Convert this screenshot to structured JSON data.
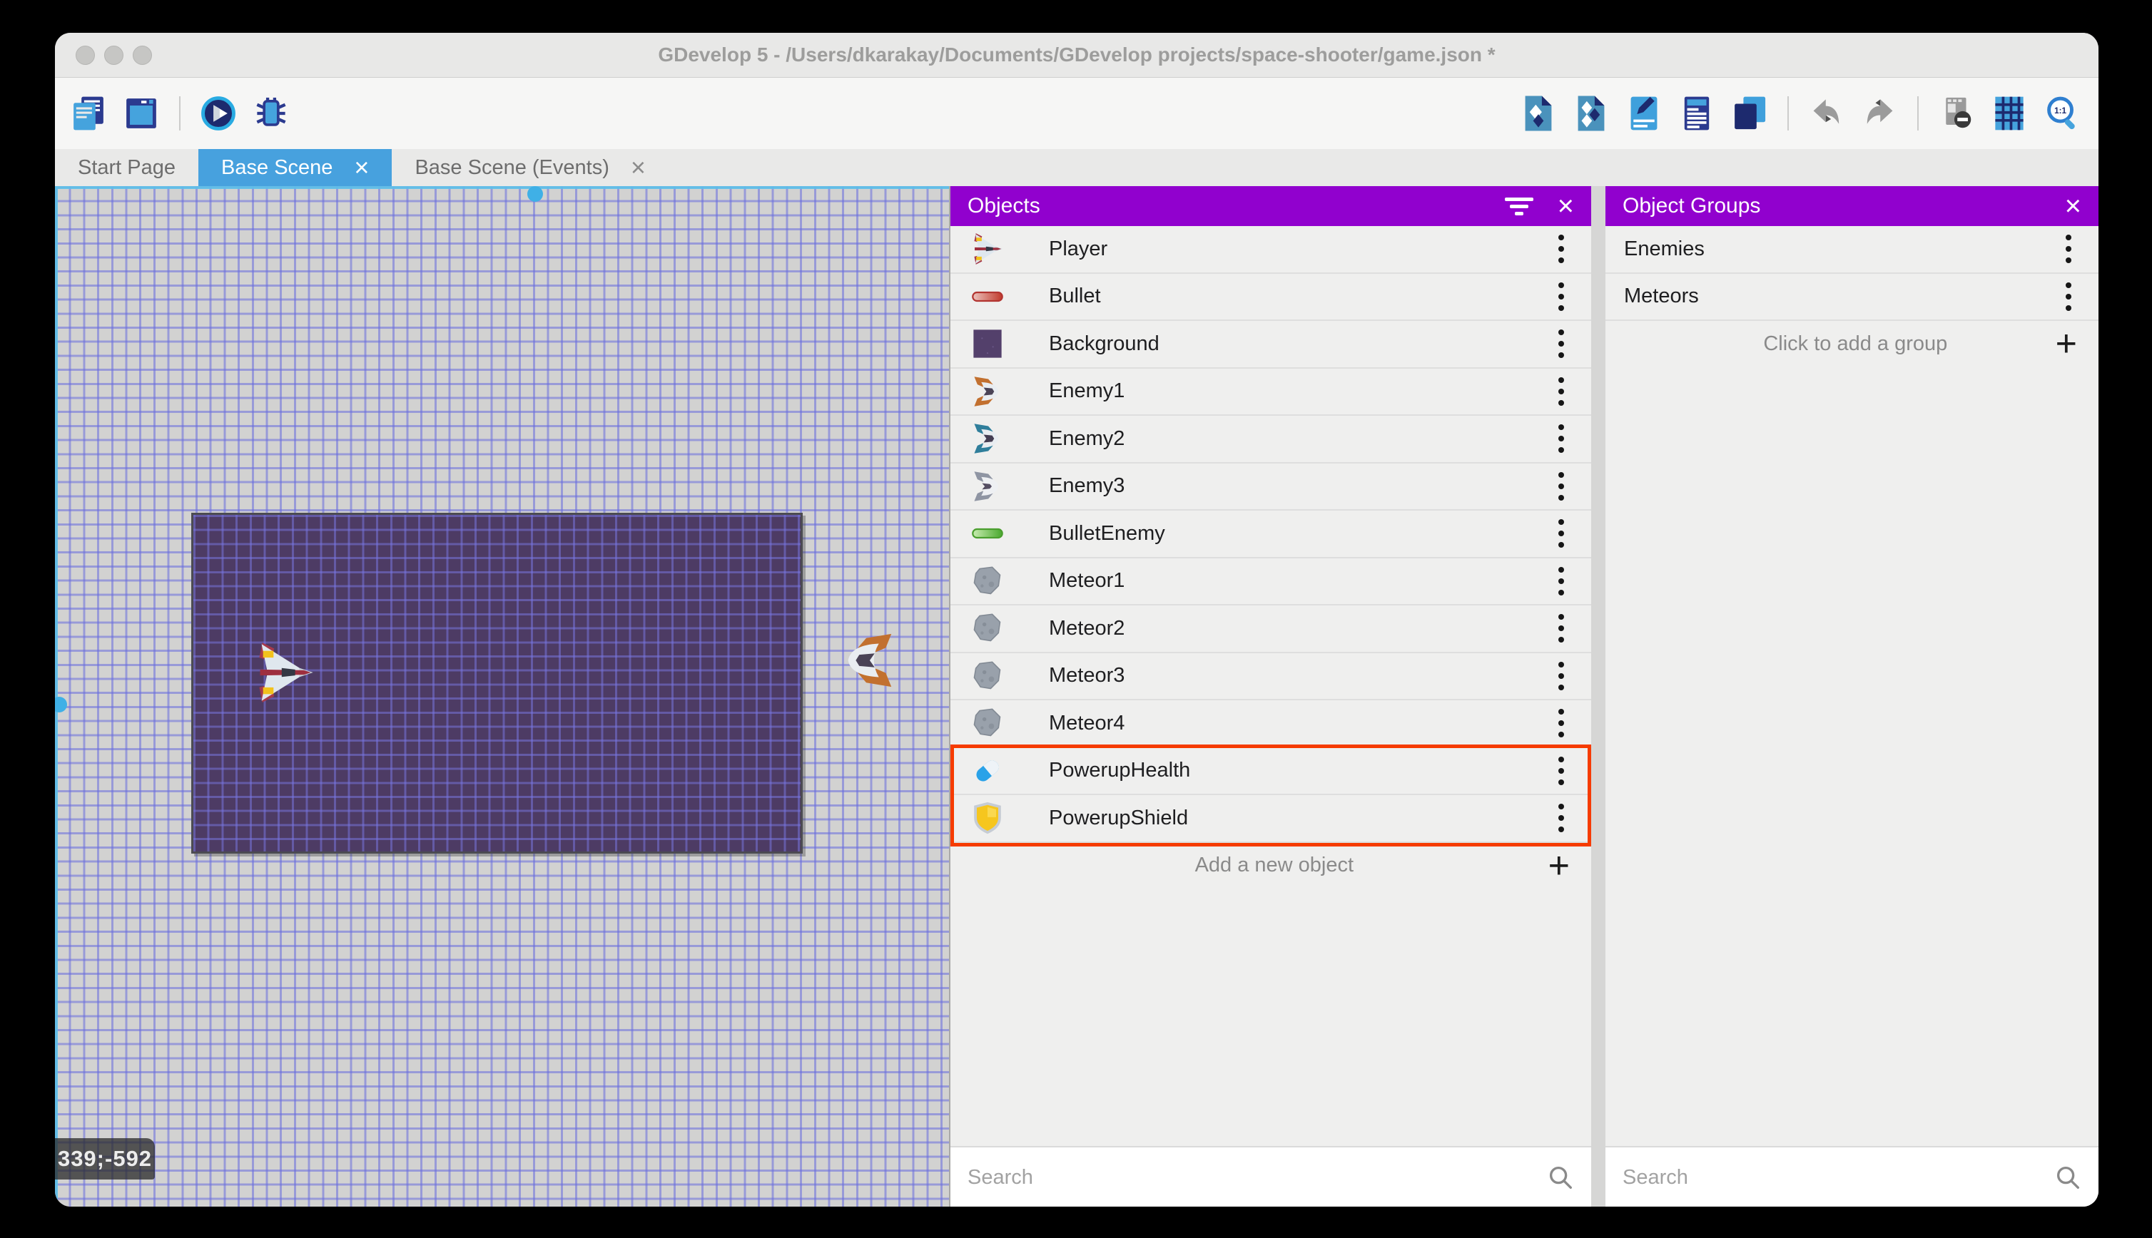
{
  "window": {
    "title": "GDevelop 5 - /Users/dkarakay/Documents/GDevelop projects/space-shooter/game.json *"
  },
  "toolbar": {
    "left": [
      {
        "name": "project-manager-icon",
        "symbol": "project"
      },
      {
        "name": "preview-window-icon",
        "symbol": "window"
      },
      {
        "separator": true
      },
      {
        "name": "play-preview-icon",
        "symbol": "play"
      },
      {
        "name": "debug-icon",
        "symbol": "debug"
      }
    ],
    "right": [
      {
        "name": "objects-panel-icon",
        "symbol": "doc-diamond"
      },
      {
        "name": "object-groups-panel-icon",
        "symbol": "doc-diamonds"
      },
      {
        "name": "properties-panel-icon",
        "symbol": "properties"
      },
      {
        "name": "instances-list-icon",
        "symbol": "instances"
      },
      {
        "name": "layers-panel-icon",
        "symbol": "layers"
      },
      {
        "separator": true
      },
      {
        "name": "undo-icon",
        "symbol": "undo"
      },
      {
        "name": "redo-icon",
        "symbol": "redo"
      },
      {
        "separator": true
      },
      {
        "name": "window-mask-icon",
        "symbol": "mask"
      },
      {
        "name": "grid-icon",
        "symbol": "grid"
      },
      {
        "name": "zoom-original-icon",
        "symbol": "zoom11"
      }
    ]
  },
  "tabs": [
    {
      "label": "Start Page",
      "active": false,
      "closable": false
    },
    {
      "label": "Base Scene",
      "active": true,
      "closable": true
    },
    {
      "label": "Base Scene (Events)",
      "active": false,
      "closable": true
    }
  ],
  "canvas": {
    "coordinates_badge": "339;-592"
  },
  "objects_panel": {
    "title": "Objects",
    "items": [
      {
        "label": "Player",
        "icon": "ship-player"
      },
      {
        "label": "Bullet",
        "icon": "bullet-red"
      },
      {
        "label": "Background",
        "icon": "background-square"
      },
      {
        "label": "Enemy1",
        "icon": "ship-orange"
      },
      {
        "label": "Enemy2",
        "icon": "ship-teal"
      },
      {
        "label": "Enemy3",
        "icon": "ship-gray"
      },
      {
        "label": "BulletEnemy",
        "icon": "bullet-green"
      },
      {
        "label": "Meteor1",
        "icon": "meteor"
      },
      {
        "label": "Meteor2",
        "icon": "meteor"
      },
      {
        "label": "Meteor3",
        "icon": "meteor"
      },
      {
        "label": "Meteor4",
        "icon": "meteor"
      },
      {
        "label": "PowerupHealth",
        "icon": "pill-health",
        "highlighted": true
      },
      {
        "label": "PowerupShield",
        "icon": "shield",
        "highlighted": true
      }
    ],
    "add_label": "Add a new object",
    "search_placeholder": "Search"
  },
  "object_groups_panel": {
    "title": "Object Groups",
    "items": [
      {
        "label": "Enemies"
      },
      {
        "label": "Meteors"
      }
    ],
    "add_label": "Click to add a group",
    "search_placeholder": "Search"
  },
  "colors": {
    "panel_header_purple": "#9101ce",
    "active_tab_blue": "#47a1de",
    "highlight_red": "#f63b00",
    "scene_background_purple": "#4d3b64",
    "canvas_gray": "#d2d2d1"
  }
}
